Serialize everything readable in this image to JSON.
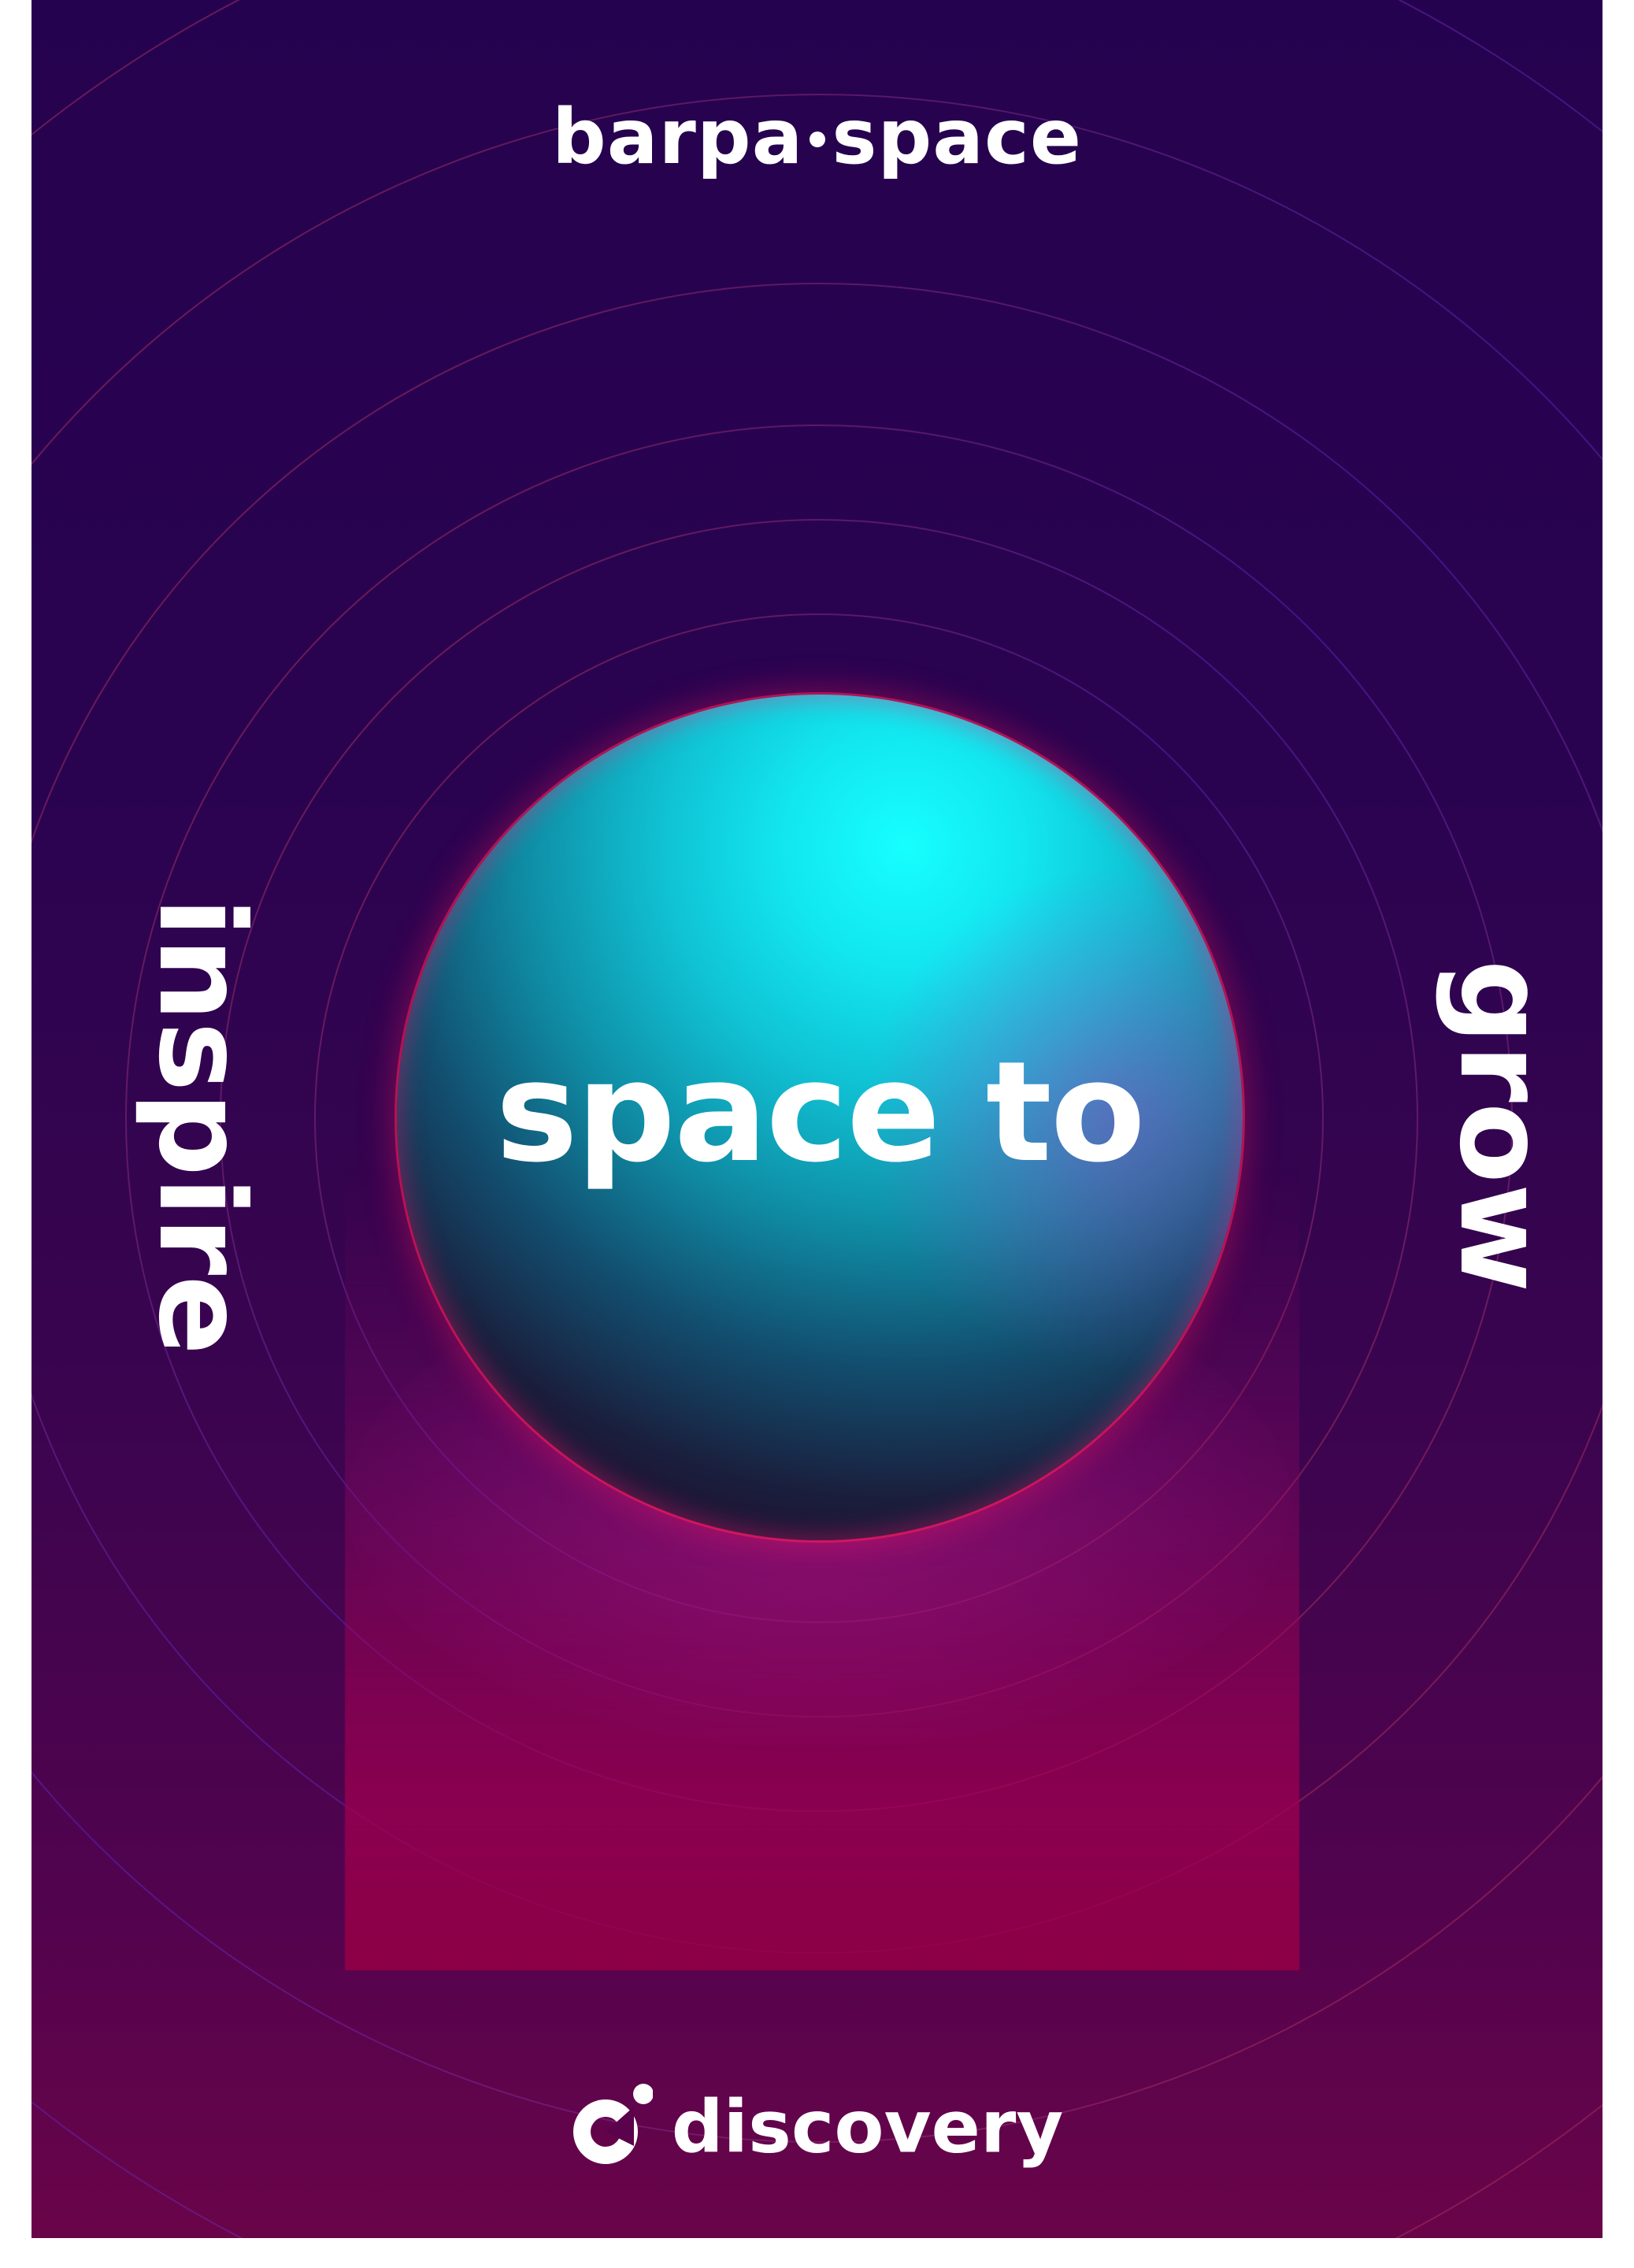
{
  "brand": {
    "name_left": "barpa",
    "name_right": "space"
  },
  "headline": {
    "text": "space to"
  },
  "side": {
    "left": "inspire",
    "right": "grow"
  },
  "footer": {
    "logo_icon": "discovery-logo-icon",
    "name": "discovery"
  },
  "colors": {
    "background_top": "#25024f",
    "background_bottom": "#6a0449",
    "sphere_highlight": "#16ffff",
    "accent_glow": "#ff1e5a",
    "text": "#ffffff"
  }
}
